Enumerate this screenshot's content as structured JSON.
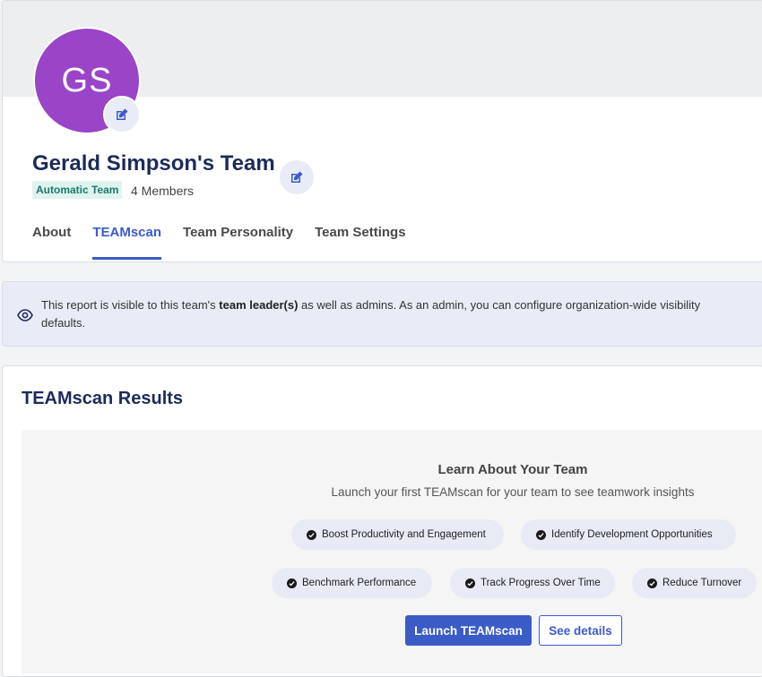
{
  "team": {
    "initials": "GS",
    "name": "Gerald Simpson's Team",
    "badge": "Automatic Team",
    "members": "4 Members"
  },
  "tabs": [
    {
      "label": "About"
    },
    {
      "label": "TEAMscan",
      "active": true
    },
    {
      "label": "Team Personality"
    },
    {
      "label": "Team Settings"
    }
  ],
  "notice": {
    "prefix": "This report is visible to this team's ",
    "bold": "team leader(s)",
    "suffix": " as well as admins. As an admin, you can configure organization-wide visibility defaults."
  },
  "results": {
    "title": "TEAMscan Results",
    "learn_title": "Learn About Your Team",
    "learn_subtitle": "Launch your first TEAMscan for your team to see teamwork insights",
    "benefits": [
      "Boost Productivity and Engagement",
      "Identify Development Opportunities",
      "Benchmark Performance",
      "Track Progress Over Time",
      "Reduce Turnover"
    ],
    "launch_label": "Launch TEAMscan",
    "details_label": "See details"
  },
  "colors": {
    "avatar": "#9a44c8",
    "accent": "#3b5bc7",
    "badge_bg": "#dff3ef",
    "badge_text": "#1a7b6b"
  },
  "icons": [
    "pencil-edit-icon",
    "eye-icon",
    "check-circle-icon"
  ]
}
